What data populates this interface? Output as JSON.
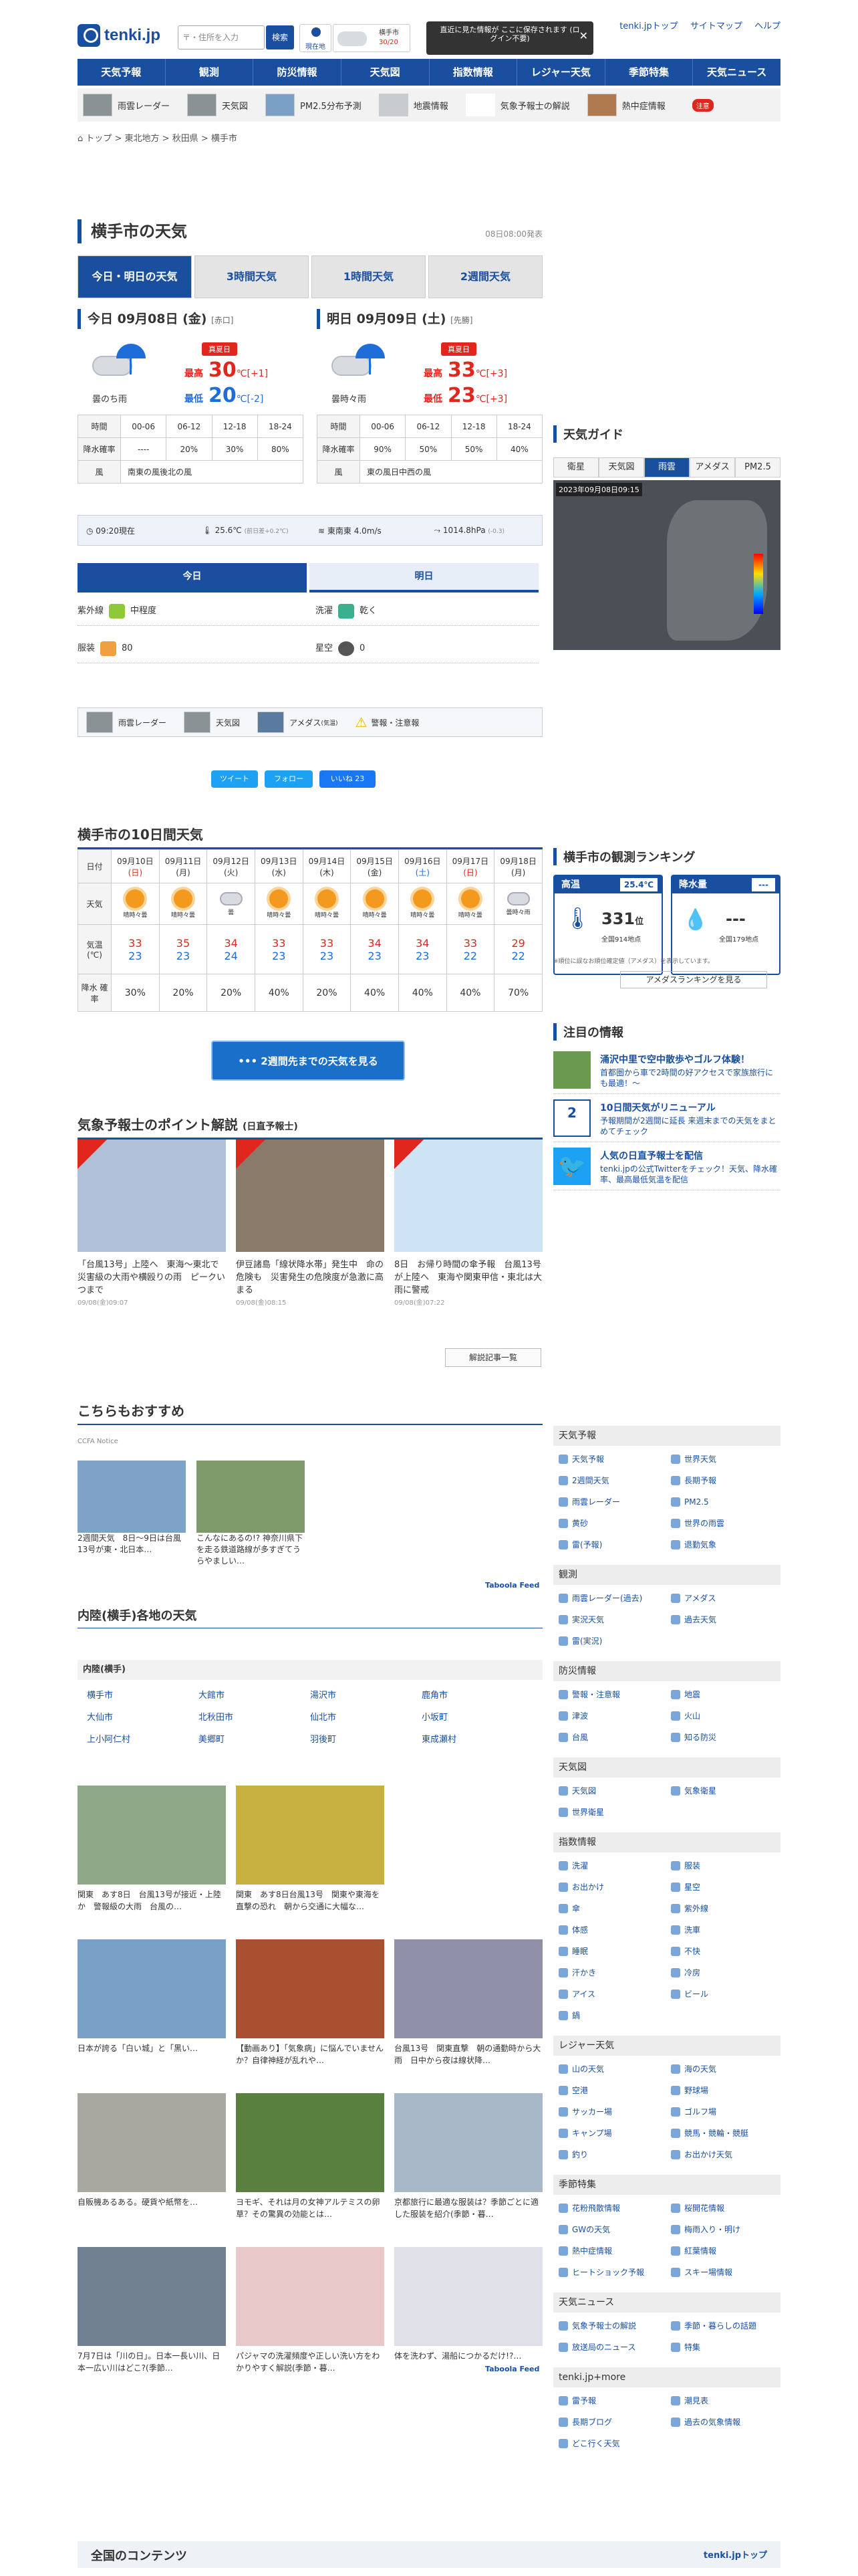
{
  "header": {
    "logo": "tenki.jp",
    "search_placeholder": "〒・住所を入力",
    "search_btn": "検索",
    "loc_btn": "現在地",
    "mini_label": "横手市",
    "mini_val": "30/20",
    "tip": "直近に見た情報が ここに保存されます (ログイン不要)",
    "links": [
      "tenki.jpトップ",
      "サイトマップ",
      "ヘルプ"
    ]
  },
  "gnav": [
    "天気予報",
    "観測",
    "防災情報",
    "天気図",
    "指数情報",
    "レジャー天気",
    "季節特集",
    "天気ニュース"
  ],
  "subnav": [
    "雨雲レーダー",
    "天気図",
    "PM2.5分布予測",
    "地震情報",
    "気象予報士の解説",
    "熱中症情報"
  ],
  "breadcrumb": "トップ > 東北地方 > 秋田県 > 横手市",
  "title": "横手市の天気",
  "updated": "08日08:00発表",
  "tabs": [
    "今日・明日の天気",
    "3時間天気",
    "1時間天気",
    "2週間天気"
  ],
  "today": {
    "head": "今日 09月08日 (金)",
    "sub": "[赤口]",
    "weather": "曇のち雨",
    "badge": "真夏日",
    "hi_label": "最高",
    "hi": "30",
    "hi_unit": "℃",
    "hi_diff": "[+1]",
    "lo_label": "最低",
    "lo": "20",
    "lo_unit": "℃",
    "lo_diff": "[-2]",
    "rain": [
      "----",
      "20%",
      "30%",
      "80%"
    ],
    "wind": "南東の風後北の風"
  },
  "tomorrow": {
    "head": "明日 09月09日 (土)",
    "sub": "[先勝]",
    "weather": "曇時々雨",
    "badge": "真夏日",
    "hi_label": "最高",
    "hi": "33",
    "hi_unit": "℃",
    "hi_diff": "[+3]",
    "lo_label": "最低",
    "lo": "23",
    "lo_unit": "℃",
    "lo_diff": "[+3]",
    "rain": [
      "90%",
      "50%",
      "50%",
      "40%"
    ],
    "wind": "東の風日中西の風"
  },
  "rain_hdr": [
    "時間",
    "00-06",
    "06-12",
    "12-18",
    "18-24"
  ],
  "rain_lbl": "降水確率",
  "wind_lbl": "風",
  "obs": {
    "time": "09:20現在",
    "temp": "25.6",
    "temp_unit": "℃",
    "temp_sub": "(前日差+0.2℃)",
    "wind": "東南東",
    "wind_val": "4.0",
    "wind_unit": "m/s",
    "press": "1014.8",
    "press_unit": "hPa",
    "press_sub": "(-0.3)"
  },
  "idx_tabs": [
    "今日",
    "明日"
  ],
  "indices": [
    {
      "name": "紫外線",
      "val": "中程度"
    },
    {
      "name": "洗濯",
      "val": "乾く"
    },
    {
      "name": "服装",
      "val": "80"
    },
    {
      "name": "星空",
      "val": "0"
    }
  ],
  "linkbar": [
    "雨雲レーダー",
    "天気図",
    "アメダス",
    "(気温)",
    "警報・注意報"
  ],
  "social": {
    "tw1": "ツイート",
    "tw2": "フォロー",
    "fb": "いいね 23"
  },
  "tenday": {
    "title": "横手市の10日間天気",
    "row_date": "日付",
    "row_w": "天気",
    "row_t": "気温 (℃)",
    "row_r": "降水 確率",
    "days": [
      {
        "d": "09月10日",
        "w": "(日)",
        "t": "晴時々曇",
        "hi": "33",
        "lo": "23",
        "r": "30%",
        "icon": "sun"
      },
      {
        "d": "09月11日",
        "w": "(月)",
        "t": "晴時々曇",
        "hi": "35",
        "lo": "23",
        "r": "20%",
        "icon": "sun"
      },
      {
        "d": "09月12日",
        "w": "(火)",
        "t": "曇",
        "hi": "34",
        "lo": "24",
        "r": "20%",
        "icon": "cloud"
      },
      {
        "d": "09月13日",
        "w": "(水)",
        "t": "晴時々曇",
        "hi": "33",
        "lo": "23",
        "r": "40%",
        "icon": "sun"
      },
      {
        "d": "09月14日",
        "w": "(木)",
        "t": "晴時々曇",
        "hi": "33",
        "lo": "23",
        "r": "20%",
        "icon": "sun"
      },
      {
        "d": "09月15日",
        "w": "(金)",
        "t": "晴時々曇",
        "hi": "34",
        "lo": "23",
        "r": "40%",
        "icon": "sun"
      },
      {
        "d": "09月16日",
        "w": "(土)",
        "t": "晴時々曇",
        "hi": "34",
        "lo": "23",
        "r": "40%",
        "icon": "sun"
      },
      {
        "d": "09月17日",
        "w": "(日)",
        "t": "晴時々曇",
        "hi": "33",
        "lo": "22",
        "r": "40%",
        "icon": "sun"
      },
      {
        "d": "09月18日",
        "w": "(月)",
        "t": "曇時々雨",
        "hi": "29",
        "lo": "22",
        "r": "70%",
        "icon": "cloud"
      }
    ],
    "more": "2週間先までの天気を見る"
  },
  "guide": {
    "title": "天気ガイド",
    "tabs": [
      "衛星",
      "天気図",
      "雨雲",
      "アメダス",
      "PM2.5"
    ],
    "stamp": "2023年09月08日09:15"
  },
  "rank": {
    "title": "横手市の観測ランキング",
    "hi": "高温",
    "hi_val": "25.4℃",
    "rank": "331",
    "rank_unit": "位",
    "total": "全国914地点",
    "rain": "降水量",
    "rain_val": "---",
    "rain_rank": "---",
    "rain_total": "全国179地点",
    "note": "※順位に誤なお順位確定値（アメダス）を表示しています。",
    "btn": "アメダスランキングを見る"
  },
  "notice": {
    "title": "注目の情報",
    "items": [
      {
        "t": "涌沢中里で空中散歩やゴルフ体験！",
        "s": "首都圏から車で2時間の好アクセスで家族旅行にも最適！～"
      },
      {
        "t": "10日間天気がリニューアル",
        "s": "予報期間が2週間に延長 来週末までの天気をまとめてチェック"
      },
      {
        "t": "人気の日直予報士を配信",
        "s": "tenki.jpの公式Twitterをチェック！天気、降水確率、最高最低気温を配信"
      }
    ]
  },
  "point": {
    "title": "気象予報士のポイント解説",
    "sub": "(日直予報士)",
    "arts": [
      {
        "t": "「台風13号」上陸へ　東海～東北で災害級の大雨や横殴りの雨　ピークいつまで",
        "d": "09/08(金)09:07"
      },
      {
        "t": "伊豆諸島「線状降水帯」発生中　命の危険も　災害発生の危険度が急激に高まる",
        "d": "09/08(金)08:15"
      },
      {
        "t": "8日　お帰り時間の傘予報　台風13号が上陸へ　東海や関東甲信・東北は大雨に警戒",
        "d": "09/08(金)07:22"
      }
    ],
    "more": "解説記事一覧"
  },
  "rec": {
    "title": "こちらもおすすめ",
    "ccfa": "CCFA Notice",
    "items": [
      {
        "t": "2週間天気　8日～9日は台風13号が東・北日本…"
      },
      {
        "t": "こんなにあるの!? 神奈川県下を走る鉄道路線が多すぎてうらやましい…"
      }
    ],
    "taboola": "Taboola Feed"
  },
  "nearby": {
    "title": "内陸(横手)各地の天気",
    "sub": "内陸(横手)",
    "cities": [
      "横手市",
      "大館市",
      "湯沢市",
      "鹿角市",
      "大仙市",
      "北秋田市",
      "仙北市",
      "小坂町",
      "上小阿仁村",
      "美郷町",
      "羽後町",
      "東成瀬村"
    ]
  },
  "tiles": [
    {
      "t": "関東　あす8日　台風13号が接近・上陸か　警報級の大雨　台風の…"
    },
    {
      "t": "関東　あす8日台風13号　関東や東海を直撃の恐れ　朝から交通に大幅な…"
    },
    {
      "t": "日本が誇る「白い城」と「黒い…"
    },
    {
      "t": "【動画あり】「気象病」に悩んでいませんか？自律神経が乱れや…"
    },
    {
      "t": "台風13号　関東直撃　朝の通勤時から大雨　日中から夜は線状降…"
    },
    {
      "t": "自販機あるある。硬貨や紙幣を…"
    },
    {
      "t": "ヨモギ、それは月の女神アルテミスの卵草？その驚異の効能とは…"
    },
    {
      "t": "京都旅行に最適な服装は？季節ごとに適した服装を紹介(季節・暮…"
    },
    {
      "t": "7月7日は「川の日」。日本一長い川、日本一広い川はどこ?(季節…"
    },
    {
      "t": "パジャマの洗濯頻度や正しい洗い方をわかりやすく解説(季節・暮…"
    },
    {
      "t": "体を洗わず、湯船につかるだけ!?…"
    }
  ],
  "sidemenu": [
    {
      "h": "天気予報",
      "i": [
        "天気予報",
        "世界天気",
        "2週間天気",
        "長期予報",
        "雨雲レーダー",
        "PM2.5",
        "黄砂",
        "世界の雨雲",
        "雷(予報)",
        "退勤気象"
      ]
    },
    {
      "h": "観測",
      "i": [
        "雨雲レーダー(過去)",
        "アメダス",
        "実況天気",
        "過去天気",
        "雷(実況)"
      ]
    },
    {
      "h": "防災情報",
      "i": [
        "警報・注意報",
        "地震",
        "津波",
        "火山",
        "台風",
        "知る防災"
      ]
    },
    {
      "h": "天気図",
      "i": [
        "天気図",
        "気象衛星",
        "世界衛星"
      ]
    },
    {
      "h": "指数情報",
      "i": [
        "洗濯",
        "服装",
        "お出かけ",
        "星空",
        "傘",
        "紫外線",
        "体感",
        "洗車",
        "睡眠",
        "不快",
        "汗かき",
        "冷房",
        "アイス",
        "ビール",
        "鍋"
      ]
    },
    {
      "h": "レジャー天気",
      "i": [
        "山の天気",
        "海の天気",
        "空港",
        "野球場",
        "サッカー場",
        "ゴルフ場",
        "キャンプ場",
        "競馬・競輪・競艇",
        "釣り",
        "お出かけ天気"
      ]
    },
    {
      "h": "季節特集",
      "i": [
        "花粉飛散情報",
        "桜開花情報",
        "GWの天気",
        "梅雨入り・明け",
        "熱中症情報",
        "紅葉情報",
        "ヒートショック予報",
        "スキー場情報"
      ]
    },
    {
      "h": "天気ニュース",
      "i": [
        "気象予報士の解説",
        "季節・暮らしの話題",
        "放送局のニュース",
        "特集"
      ]
    },
    {
      "h": "tenki.jp+more",
      "i": [
        "雷予報",
        "潮見表",
        "長期ブログ",
        "過去の気象情報",
        "どこ行く天気"
      ]
    }
  ],
  "footer": {
    "title": "全国のコンテンツ",
    "link": "tenki.jpトップ"
  }
}
